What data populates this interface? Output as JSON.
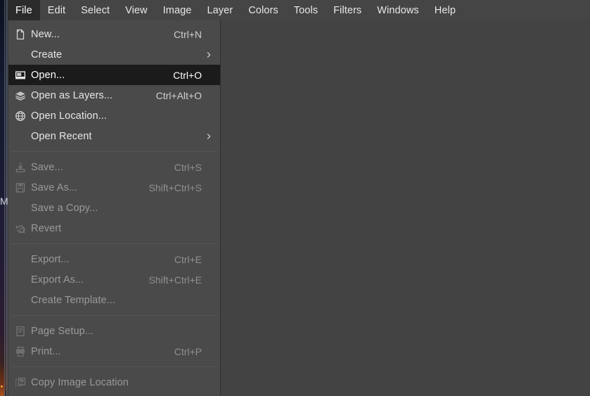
{
  "app": {
    "name": "GIMP",
    "background_color": "#434343",
    "menu_background": "#4a4a4a",
    "menubar_background": "#454545",
    "highlight_color": "#1b1b1b",
    "text_color": "#e6e6e6",
    "disabled_text_color": "#9a9a9a"
  },
  "menubar": {
    "items": [
      {
        "label": "File",
        "active": true
      },
      {
        "label": "Edit",
        "active": false
      },
      {
        "label": "Select",
        "active": false
      },
      {
        "label": "View",
        "active": false
      },
      {
        "label": "Image",
        "active": false
      },
      {
        "label": "Layer",
        "active": false
      },
      {
        "label": "Colors",
        "active": false
      },
      {
        "label": "Tools",
        "active": false
      },
      {
        "label": "Filters",
        "active": false
      },
      {
        "label": "Windows",
        "active": false
      },
      {
        "label": "Help",
        "active": false
      }
    ]
  },
  "background": {
    "partial_glyph": "M"
  },
  "file_menu": {
    "groups": [
      {
        "items": [
          {
            "label": "New...",
            "accel": "Ctrl+N",
            "icon": "new-file-icon",
            "enabled": true,
            "selected": false,
            "submenu": false
          },
          {
            "label": "Create",
            "accel": "",
            "icon": "",
            "enabled": true,
            "selected": false,
            "submenu": true
          },
          {
            "label": "Open...",
            "accel": "Ctrl+O",
            "icon": "open-file-icon",
            "enabled": true,
            "selected": true,
            "submenu": false
          },
          {
            "label": "Open as Layers...",
            "accel": "Ctrl+Alt+O",
            "icon": "open-as-layers-icon",
            "enabled": true,
            "selected": false,
            "submenu": false
          },
          {
            "label": "Open Location...",
            "accel": "",
            "icon": "globe-icon",
            "enabled": true,
            "selected": false,
            "submenu": false
          },
          {
            "label": "Open Recent",
            "accel": "",
            "icon": "",
            "enabled": true,
            "selected": false,
            "submenu": true
          }
        ]
      },
      {
        "items": [
          {
            "label": "Save...",
            "accel": "Ctrl+S",
            "icon": "save-icon",
            "enabled": false,
            "selected": false,
            "submenu": false
          },
          {
            "label": "Save As...",
            "accel": "Shift+Ctrl+S",
            "icon": "save-as-icon",
            "enabled": false,
            "selected": false,
            "submenu": false
          },
          {
            "label": "Save a Copy...",
            "accel": "",
            "icon": "",
            "enabled": false,
            "selected": false,
            "submenu": false
          },
          {
            "label": "Revert",
            "accel": "",
            "icon": "revert-icon",
            "enabled": false,
            "selected": false,
            "submenu": false
          }
        ]
      },
      {
        "items": [
          {
            "label": "Export...",
            "accel": "Ctrl+E",
            "icon": "",
            "enabled": false,
            "selected": false,
            "submenu": false
          },
          {
            "label": "Export As...",
            "accel": "Shift+Ctrl+E",
            "icon": "",
            "enabled": false,
            "selected": false,
            "submenu": false
          },
          {
            "label": "Create Template...",
            "accel": "",
            "icon": "",
            "enabled": false,
            "selected": false,
            "submenu": false
          }
        ]
      },
      {
        "items": [
          {
            "label": "Page Setup...",
            "accel": "",
            "icon": "page-setup-icon",
            "enabled": false,
            "selected": false,
            "submenu": false
          },
          {
            "label": "Print...",
            "accel": "Ctrl+P",
            "icon": "print-icon",
            "enabled": false,
            "selected": false,
            "submenu": false
          }
        ]
      },
      {
        "items": [
          {
            "label": "Copy Image Location",
            "accel": "",
            "icon": "copy-location-icon",
            "enabled": false,
            "selected": false,
            "submenu": false
          }
        ]
      }
    ]
  }
}
